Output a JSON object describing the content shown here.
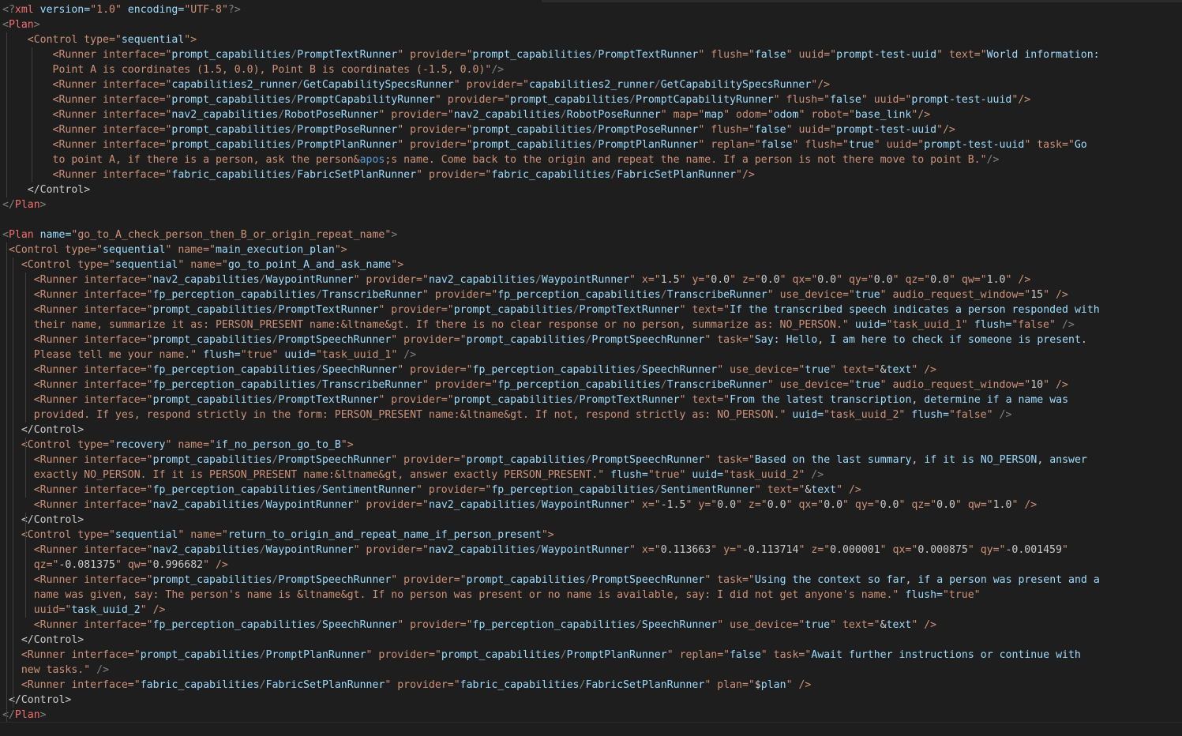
{
  "editor": {
    "language": "xml",
    "lines": [
      "<?xml version=\"1.0\" encoding=\"UTF-8\"?>",
      "<Plan>",
      "    <Control type=\"sequential\">",
      "        <Runner interface=\"prompt_capabilities/PromptTextRunner\" provider=\"prompt_capabilities/PromptTextRunner\" flush=\"false\" uuid=\"prompt-test-uuid\" text=\"World information:",
      "        Point A is coordinates (1.5, 0.0), Point B is coordinates (-1.5, 0.0)\"/>",
      "        <Runner interface=\"capabilities2_runner/GetCapabilitySpecsRunner\" provider=\"capabilities2_runner/GetCapabilitySpecsRunner\"/>",
      "        <Runner interface=\"prompt_capabilities/PromptCapabilityRunner\" provider=\"prompt_capabilities/PromptCapabilityRunner\" flush=\"false\" uuid=\"prompt-test-uuid\"/>",
      "        <Runner interface=\"nav2_capabilities/RobotPoseRunner\" provider=\"nav2_capabilities/RobotPoseRunner\" map=\"map\" odom=\"odom\" robot=\"base_link\"/>",
      "        <Runner interface=\"prompt_capabilities/PromptPoseRunner\" provider=\"prompt_capabilities/PromptPoseRunner\" flush=\"false\" uuid=\"prompt-test-uuid\"/>",
      "        <Runner interface=\"prompt_capabilities/PromptPlanRunner\" provider=\"prompt_capabilities/PromptPlanRunner\" replan=\"false\" flush=\"true\" uuid=\"prompt-test-uuid\" task=\"Go",
      "        to point A, if there is a person, ask the person&apos;s name. Come back to the origin and repeat the name. If a person is not there move to point B.\"/>",
      "        <Runner interface=\"fabric_capabilities/FabricSetPlanRunner\" provider=\"fabric_capabilities/FabricSetPlanRunner\"/>",
      "    </Control>",
      "</Plan>",
      "",
      "<Plan name=\"go_to_A_check_person_then_B_or_origin_repeat_name\">",
      " <Control type=\"sequential\" name=\"main_execution_plan\">",
      "   <Control type=\"sequential\" name=\"go_to_point_A_and_ask_name\">",
      "     <Runner interface=\"nav2_capabilities/WaypointRunner\" provider=\"nav2_capabilities/WaypointRunner\" x=\"1.5\" y=\"0.0\" z=\"0.0\" qx=\"0.0\" qy=\"0.0\" qz=\"0.0\" qw=\"1.0\" />",
      "     <Runner interface=\"fp_perception_capabilities/TranscribeRunner\" provider=\"fp_perception_capabilities/TranscribeRunner\" use_device=\"true\" audio_request_window=\"15\" />",
      "     <Runner interface=\"prompt_capabilities/PromptTextRunner\" provider=\"prompt_capabilities/PromptTextRunner\" text=\"If the transcribed speech indicates a person responded with",
      "     their name, summarize it as: PERSON_PRESENT name:&ltname&gt. If there is no clear response or no person, summarize as: NO_PERSON.\" uuid=\"task_uuid_1\" flush=\"false\" />",
      "     <Runner interface=\"prompt_capabilities/PromptSpeechRunner\" provider=\"prompt_capabilities/PromptSpeechRunner\" task=\"Say: Hello, I am here to check if someone is present.",
      "     Please tell me your name.\" flush=\"true\" uuid=\"task_uuid_1\" />",
      "     <Runner interface=\"fp_perception_capabilities/SpeechRunner\" provider=\"fp_perception_capabilities/SpeechRunner\" use_device=\"true\" text=\"&text\" />",
      "     <Runner interface=\"fp_perception_capabilities/TranscribeRunner\" provider=\"fp_perception_capabilities/TranscribeRunner\" use_device=\"true\" audio_request_window=\"10\" />",
      "     <Runner interface=\"prompt_capabilities/PromptTextRunner\" provider=\"prompt_capabilities/PromptTextRunner\" text=\"From the latest transcription, determine if a name was",
      "     provided. If yes, respond strictly in the form: PERSON_PRESENT name:&ltname&gt. If not, respond strictly as: NO_PERSON.\" uuid=\"task_uuid_2\" flush=\"false\" />",
      "   </Control>",
      "   <Control type=\"recovery\" name=\"if_no_person_go_to_B\">",
      "     <Runner interface=\"prompt_capabilities/PromptSpeechRunner\" provider=\"prompt_capabilities/PromptSpeechRunner\" task=\"Based on the last summary, if it is NO_PERSON, answer",
      "     exactly NO_PERSON. If it is PERSON_PRESENT name:&ltname&gt, answer exactly PERSON_PRESENT.\" flush=\"true\" uuid=\"task_uuid_2\" />",
      "     <Runner interface=\"fp_perception_capabilities/SentimentRunner\" provider=\"fp_perception_capabilities/SentimentRunner\" text=\"&text\" />",
      "     <Runner interface=\"nav2_capabilities/WaypointRunner\" provider=\"nav2_capabilities/WaypointRunner\" x=\"-1.5\" y=\"0.0\" z=\"0.0\" qx=\"0.0\" qy=\"0.0\" qz=\"0.0\" qw=\"1.0\" />",
      "   </Control>",
      "   <Control type=\"sequential\" name=\"return_to_origin_and_repeat_name_if_person_present\">",
      "     <Runner interface=\"nav2_capabilities/WaypointRunner\" provider=\"nav2_capabilities/WaypointRunner\" x=\"0.113663\" y=\"-0.113714\" z=\"0.000001\" qx=\"0.000875\" qy=\"-0.001459\"",
      "     qz=\"-0.081375\" qw=\"0.996682\" />",
      "     <Runner interface=\"prompt_capabilities/PromptSpeechRunner\" provider=\"prompt_capabilities/PromptSpeechRunner\" task=\"Using the context so far, if a person was present and a",
      "     name was given, say: The person's name is &ltname&gt. If no person was present or no name is available, say: I did not get anyone's name.\" flush=\"true\"",
      "     uuid=\"task_uuid_2\" />",
      "     <Runner interface=\"fp_perception_capabilities/SpeechRunner\" provider=\"fp_perception_capabilities/SpeechRunner\" use_device=\"true\" text=\"&text\" />",
      "   </Control>",
      "   <Runner interface=\"prompt_capabilities/PromptPlanRunner\" provider=\"prompt_capabilities/PromptPlanRunner\" replan=\"false\" task=\"Await further instructions or continue with",
      "   new tasks.\" />",
      "   <Runner interface=\"fabric_capabilities/FabricSetPlanRunner\" provider=\"fabric_capabilities/FabricSetPlanRunner\" plan=\"$plan\" />",
      " </Control>",
      "</Plan>"
    ]
  }
}
